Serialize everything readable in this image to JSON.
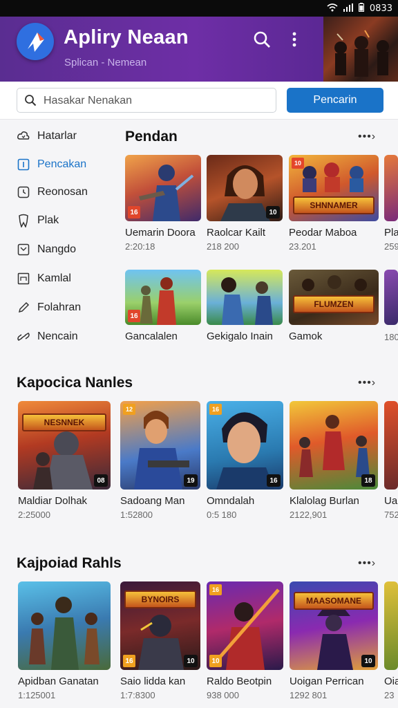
{
  "status": {
    "time": "0833"
  },
  "header": {
    "title": "Apliry Neaan",
    "subtitle": "Splican - Nemean"
  },
  "search": {
    "placeholder": "Hasakar Nenakan",
    "button": "Pencarin"
  },
  "sidebar": {
    "items": [
      {
        "label": "Hatarlar",
        "icon": "cloud-icon",
        "active": false
      },
      {
        "label": "Pencakan",
        "icon": "square-icon",
        "active": true
      },
      {
        "label": "Reonosan",
        "icon": "clock-icon",
        "active": false
      },
      {
        "label": "Plak",
        "icon": "tooth-icon",
        "active": false
      },
      {
        "label": "Nangdo",
        "icon": "box-icon",
        "active": false
      },
      {
        "label": "Kamlal",
        "icon": "frame-icon",
        "active": false
      },
      {
        "label": "Folahran",
        "icon": "pencil-icon",
        "active": false
      },
      {
        "label": "Nencain",
        "icon": "link-icon",
        "active": false
      }
    ]
  },
  "sections": [
    {
      "title": "Pendan",
      "more": "•••›",
      "cards": [
        {
          "name": "Uemarin Doora",
          "meta": "2:20:18",
          "badge_left": "16",
          "badge_right": "",
          "badge_top": "",
          "banner": ""
        },
        {
          "name": "Raolcar Kailt",
          "meta": "218 200",
          "badge_left": "",
          "badge_right": "10",
          "badge_top": "",
          "banner": ""
        },
        {
          "name": "Peodar Maboa",
          "meta": "23.201",
          "badge_left": "",
          "badge_right": "",
          "badge_top": "10",
          "banner": "SHNNAMER"
        },
        {
          "name": "Pla",
          "meta": "259",
          "badge_left": "",
          "badge_right": "",
          "badge_top": "",
          "banner": ""
        },
        {
          "name": "Gancalalen",
          "meta": "",
          "badge_left": "16",
          "badge_right": "",
          "badge_top": "",
          "banner": ""
        },
        {
          "name": "Gekigalo Inain",
          "meta": "",
          "badge_left": "",
          "badge_right": "",
          "badge_top": "",
          "banner": ""
        },
        {
          "name": "Gamok",
          "meta": "",
          "badge_left": "",
          "badge_right": "",
          "badge_top": "",
          "banner": "FLUMZEN"
        },
        {
          "name": "",
          "meta": "180",
          "badge_left": "",
          "badge_right": "",
          "badge_top": "",
          "banner": ""
        }
      ]
    },
    {
      "title": "Kapocica Nanles",
      "more": "•••›",
      "cards": [
        {
          "name": "Maldiar Dolhak",
          "meta": "2:25000",
          "badge_left": "",
          "badge_right": "08",
          "badge_top": "",
          "banner": "NESNNEK"
        },
        {
          "name": "Sadoang Man",
          "meta": "1:52800",
          "badge_left": "",
          "badge_right": "19",
          "badge_top": "12",
          "banner": ""
        },
        {
          "name": "Omndalah",
          "meta": "0:5 180",
          "badge_left": "",
          "badge_right": "16",
          "badge_top": "16",
          "banner": ""
        },
        {
          "name": "Klalolag Burlan",
          "meta": "2122,901",
          "badge_left": "",
          "badge_right": "18",
          "badge_top": "",
          "banner": ""
        },
        {
          "name": "Ua",
          "meta": "752",
          "badge_left": "",
          "badge_right": "",
          "badge_top": "",
          "banner": ""
        }
      ]
    },
    {
      "title": "Kajpoiad Rahls",
      "more": "•••›",
      "cards": [
        {
          "name": "Apidban Ganatan",
          "meta": "1:125001",
          "badge_left": "",
          "badge_right": "",
          "badge_top": "",
          "banner": ""
        },
        {
          "name": "Saio lidda kan",
          "meta": "1:7:8300",
          "badge_left": "16",
          "badge_right": "10",
          "badge_top": "",
          "banner": "BYNOIRS"
        },
        {
          "name": "Raldo Beotpin",
          "meta": "938 000",
          "badge_left": "10",
          "badge_right": "",
          "badge_top": "16",
          "banner": ""
        },
        {
          "name": "Uoigan Perrican",
          "meta": "1292 801",
          "badge_left": "",
          "badge_right": "10",
          "badge_top": "",
          "banner": "MAASOMANE"
        },
        {
          "name": "Oia",
          "meta": "23",
          "badge_left": "",
          "badge_right": "",
          "badge_top": "",
          "banner": ""
        }
      ]
    }
  ],
  "colors": {
    "header": "#6e2ea6",
    "accent": "#1a73c8",
    "badge": "#e0462b"
  }
}
